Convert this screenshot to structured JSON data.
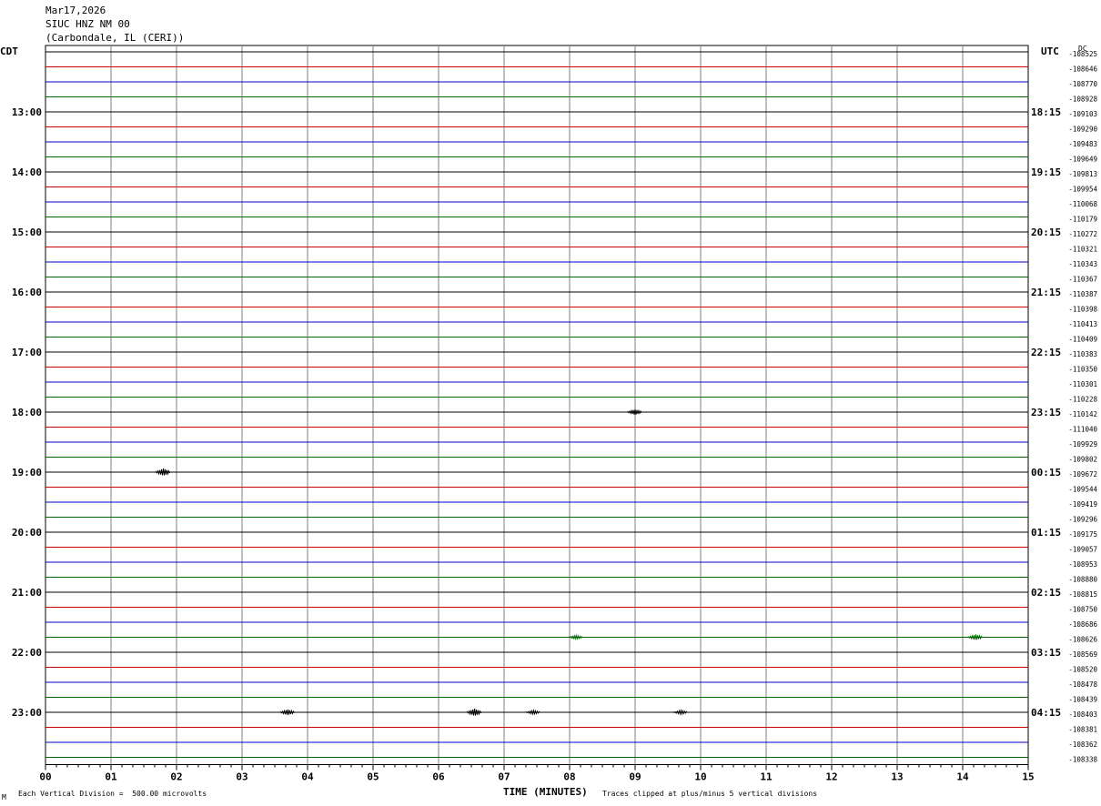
{
  "header": {
    "date": "Mar17,2026",
    "station": "SIUC HNZ NM 00",
    "location": "(Carbondale, IL (CERI))"
  },
  "labels": {
    "left_tz": "CDT",
    "right_tz": "UTC",
    "dc": "DC",
    "footer_scale": "Each Vertical Division =  500.00 microvolts",
    "footer_clip": "Traces clipped at plus/minus 5 vertical divisions",
    "corner_mark": "M"
  },
  "colors": {
    "black": "#000000",
    "red": "#cc0000",
    "blue": "#0000cc",
    "green": "#006600",
    "grid": "#808080"
  },
  "chart_data": {
    "type": "line",
    "xlabel": "TIME (MINUTES)",
    "xlim": [
      0,
      15
    ],
    "x_ticks": [
      "00",
      "01",
      "02",
      "03",
      "04",
      "05",
      "06",
      "07",
      "08",
      "09",
      "10",
      "11",
      "12",
      "13",
      "14",
      "15"
    ],
    "trace_color_cycle": [
      "black",
      "red",
      "blue",
      "green"
    ],
    "left_hour_labels": [
      {
        "row": 4,
        "text": "13:00"
      },
      {
        "row": 8,
        "text": "14:00"
      },
      {
        "row": 12,
        "text": "15:00"
      },
      {
        "row": 16,
        "text": "16:00"
      },
      {
        "row": 20,
        "text": "17:00"
      },
      {
        "row": 24,
        "text": "18:00"
      },
      {
        "row": 28,
        "text": "19:00"
      },
      {
        "row": 32,
        "text": "20:00"
      },
      {
        "row": 36,
        "text": "21:00"
      },
      {
        "row": 40,
        "text": "22:00"
      },
      {
        "row": 44,
        "text": "23:00"
      }
    ],
    "right_hour_labels": [
      {
        "row": 4,
        "text": "18:15"
      },
      {
        "row": 8,
        "text": "19:15"
      },
      {
        "row": 12,
        "text": "20:15"
      },
      {
        "row": 16,
        "text": "21:15"
      },
      {
        "row": 20,
        "text": "22:15"
      },
      {
        "row": 24,
        "text": "23:15"
      },
      {
        "row": 28,
        "text": "00:15"
      },
      {
        "row": 32,
        "text": "01:15"
      },
      {
        "row": 36,
        "text": "02:15"
      },
      {
        "row": 40,
        "text": "03:15"
      },
      {
        "row": 44,
        "text": "04:15"
      }
    ],
    "dc_offsets": [
      "-108525",
      "-108646",
      "-108770",
      "-108928",
      "-109103",
      "-109290",
      "-109483",
      "-109649",
      "-109813",
      "-109954",
      "-110068",
      "-110179",
      "-110272",
      "-110321",
      "-110343",
      "-110367",
      "-110387",
      "-110398",
      "-110413",
      "-110409",
      "-110383",
      "-110350",
      "-110301",
      "-110228",
      "-110142",
      "-111040",
      "-109929",
      "-109802",
      "-109672",
      "-109544",
      "-109419",
      "-109296",
      "-109175",
      "-109057",
      "-108953",
      "-108880",
      "-108815",
      "-108750",
      "-108686",
      "-108626",
      "-108569",
      "-108520",
      "-108478",
      "-108439",
      "-108403",
      "-108381",
      "-108362",
      "-108338"
    ],
    "events": [
      {
        "row": 28,
        "minute": 1.8,
        "amplitude": 4
      },
      {
        "row": 44,
        "minute": 3.7,
        "amplitude": 3
      },
      {
        "row": 44,
        "minute": 6.55,
        "amplitude": 4
      },
      {
        "row": 44,
        "minute": 7.45,
        "amplitude": 2
      },
      {
        "row": 44,
        "minute": 9.7,
        "amplitude": 2
      },
      {
        "row": 24,
        "minute": 9.0,
        "amplitude": 3
      },
      {
        "row": 39,
        "minute": 8.1,
        "amplitude": 2
      },
      {
        "row": 39,
        "minute": 14.2,
        "amplitude": 3
      }
    ]
  }
}
